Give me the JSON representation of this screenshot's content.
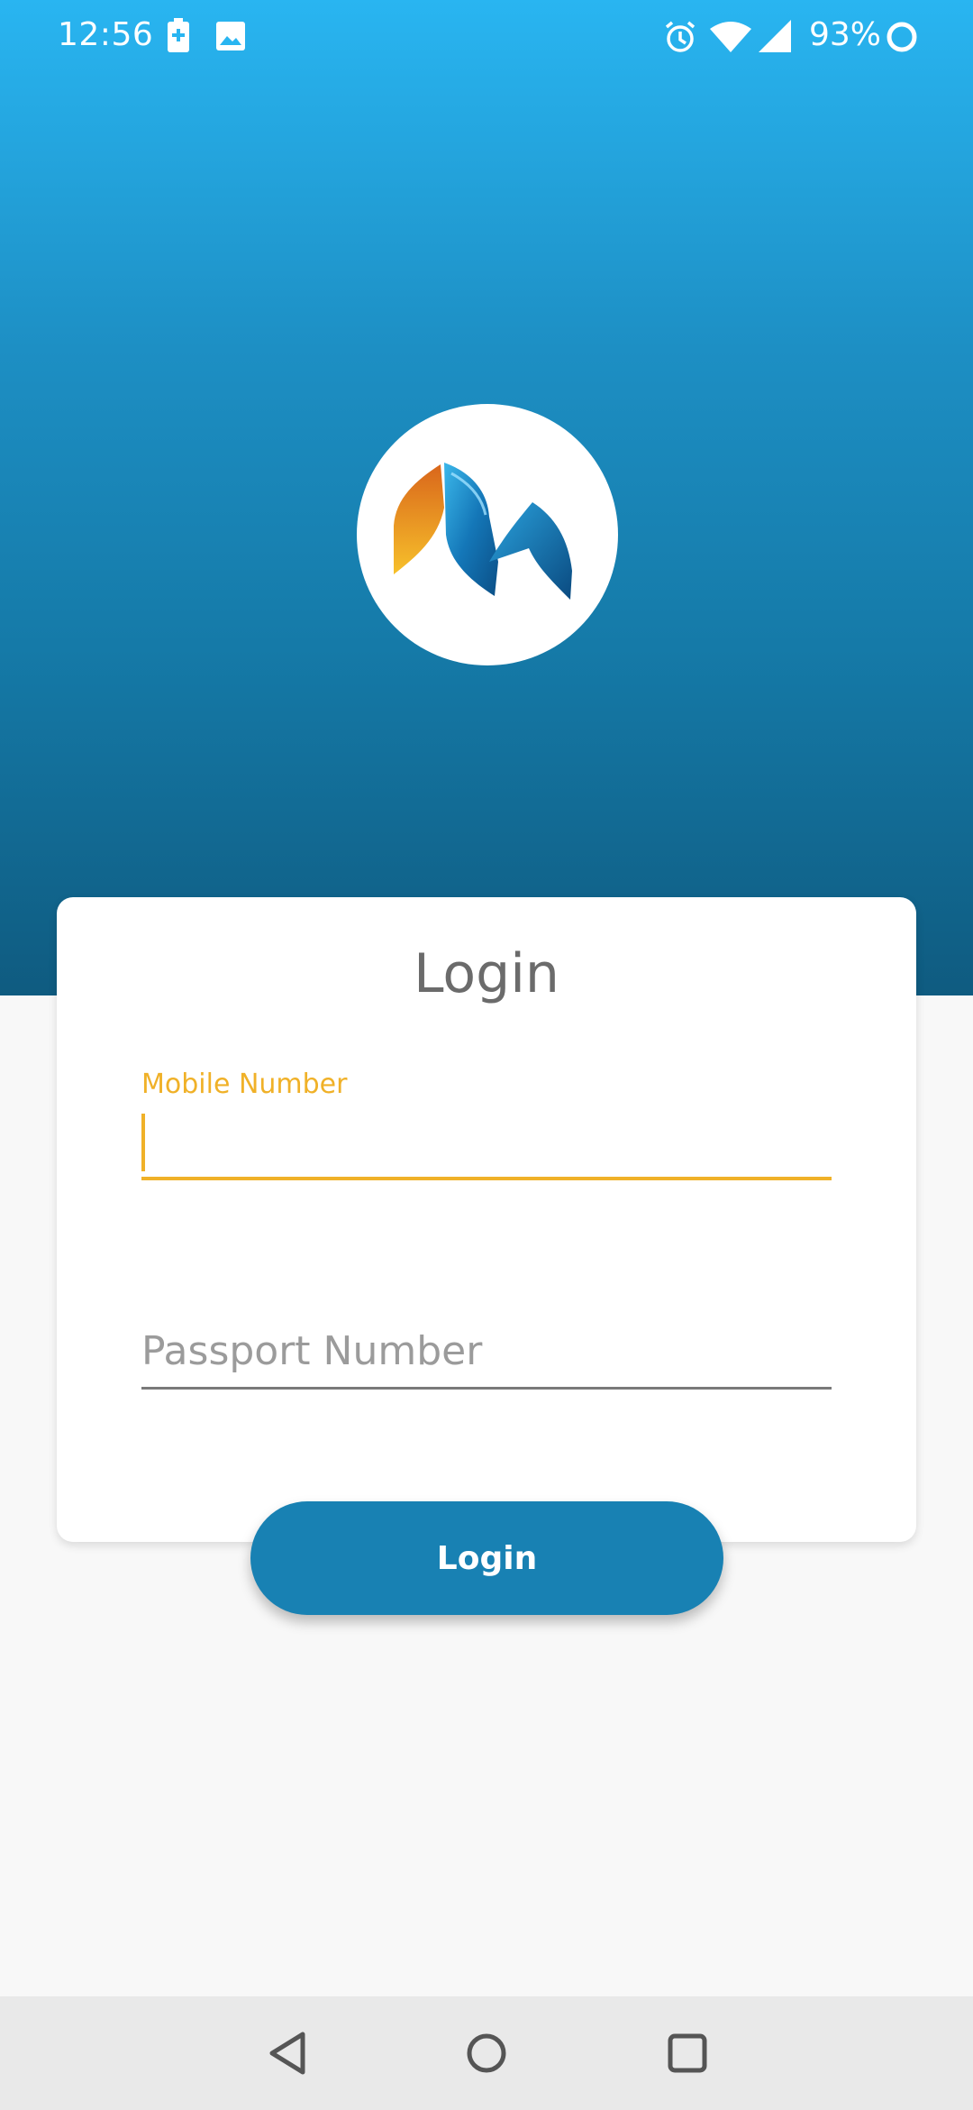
{
  "status_bar": {
    "time": "12:56",
    "battery_percent": "93%",
    "icons": [
      "battery-charging-icon",
      "gallery-icon",
      "alarm-icon",
      "wifi-icon",
      "signal-icon",
      "battery-ring-icon"
    ]
  },
  "colors": {
    "header_top": "#29b5f1",
    "header_bottom": "#0f5b80",
    "accent": "#f0b128",
    "button": "#1881b3"
  },
  "logo": {
    "icon": "app-logo-icon"
  },
  "card": {
    "title": "Login",
    "mobile_label": "Mobile Number",
    "mobile_value": "",
    "passport_placeholder": "Passport Number",
    "passport_value": ""
  },
  "login_button": {
    "label": "Login"
  },
  "nav_bar": {
    "icons": [
      "back-icon",
      "home-icon",
      "recents-icon"
    ]
  }
}
